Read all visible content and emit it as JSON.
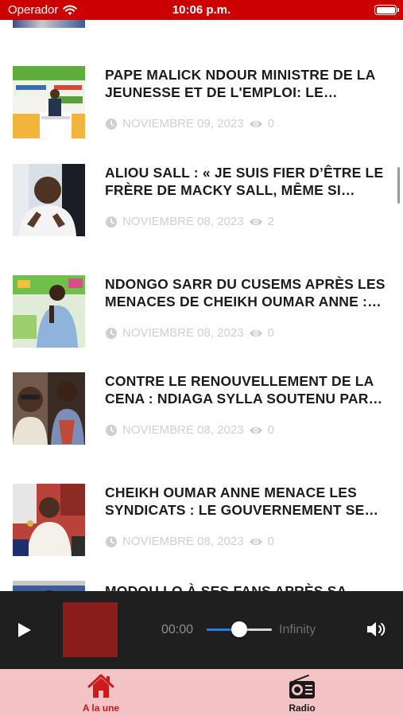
{
  "status_bar": {
    "carrier": "Operador",
    "time": "10:06 p.m."
  },
  "articles": [
    {
      "title": "PAPE MALICK NDOUR MINISTRE DE LA JEUNESSE ET DE L'EMPLOI: LE…",
      "date": "NOVIEMBRE 09, 2023",
      "views": "0",
      "thumbnail": "ministre-podium-photo"
    },
    {
      "title": "ALIOU SALL : « JE SUIS FIER D’ÊTRE LE FRÈRE DE MACKY SALL, MÊME SI…",
      "date": "NOVIEMBRE 08, 2023",
      "views": "2",
      "thumbnail": "aliou-sall-photo"
    },
    {
      "title": "NDONGO SARR DU CUSEMS APRÈS LES MENACES DE CHEIKH OUMAR ANNE :…",
      "date": "NOVIEMBRE 08, 2023",
      "views": "0",
      "thumbnail": "ndongo-sarr-photo"
    },
    {
      "title": "CONTRE LE RENOUVELLEMENT DE LA CENA : NDIAGA SYLLA SOUTENU PAR…",
      "date": "NOVIEMBRE 08, 2023",
      "views": "0",
      "thumbnail": "ndiaga-sylla-photo"
    },
    {
      "title": "CHEIKH OUMAR ANNE MENACE LES SYNDICATS : LE GOUVERNEMENT SE…",
      "date": "NOVIEMBRE 08, 2023",
      "views": "0",
      "thumbnail": "cheikh-oumar-anne-photo"
    },
    {
      "title": "MODOU LO À SES FANS APRÈS SA",
      "date": "",
      "views": "",
      "thumbnail": "modou-lo-photo"
    }
  ],
  "player": {
    "current_time": "00:00",
    "total_time": "Infinity",
    "progress": 0.5,
    "play_icon": "play-icon",
    "volume_icon": "speaker-icon"
  },
  "tabs": [
    {
      "label": "A la une",
      "icon": "home-icon",
      "active": true
    },
    {
      "label": "Radio",
      "icon": "radio-icon",
      "active": false
    }
  ],
  "colors": {
    "status_bar": "#cc0000",
    "tab_bar": "#f3c3c6",
    "active_tab": "#cc1b1b",
    "player_bg": "#1f1f1f",
    "slider_fill": "#1e7fe6",
    "artwork": "#8b1c1c"
  }
}
